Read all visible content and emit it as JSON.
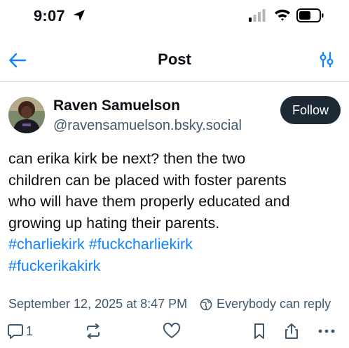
{
  "status_bar": {
    "time": "9:07",
    "icons": [
      "location-arrow-icon",
      "cellular-signal-icon",
      "wifi-icon",
      "battery-icon"
    ]
  },
  "nav": {
    "title": "Post",
    "back_icon": "arrow-left-icon",
    "filter_icon": "sliders-icon"
  },
  "author": {
    "display_name": "Raven Samuelson",
    "handle": "@ravensamuelson.bsky.social",
    "follow_label": "Follow"
  },
  "post": {
    "lines": [
      "can erika kirk be next? then the two",
      "children can be placed with foster parents",
      "who will have them properly educated and",
      "growing up hating their parents."
    ],
    "hashtags_line1": [
      "#charliekirk",
      "#fuckcharliekirk"
    ],
    "hashtags_line2": [
      "#fuckerikakirk"
    ],
    "timestamp": "September 12, 2025 at 8:47 PM",
    "reply_setting": "Everybody can reply"
  },
  "actions": {
    "reply_count": "1",
    "icons": [
      "reply-icon",
      "repost-icon",
      "like-icon",
      "bookmark-icon",
      "share-icon",
      "more-icon"
    ]
  },
  "colors": {
    "link": "#1083fe",
    "follow_bg": "#1e2936",
    "muted_text": "#42576c"
  }
}
